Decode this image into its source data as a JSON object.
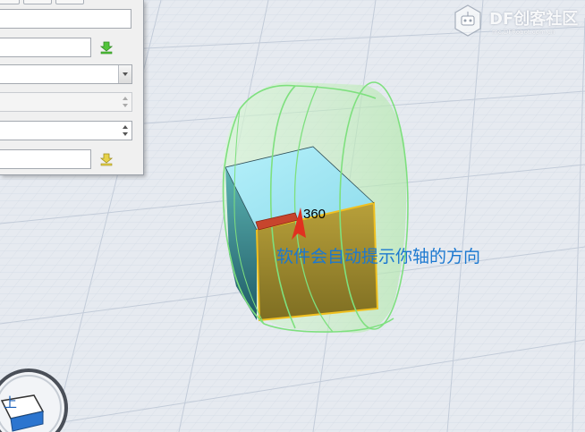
{
  "annotation": {
    "text": "软件会自动提示你轴的方向"
  },
  "dimension": {
    "value": "360"
  },
  "watermark": {
    "brand_prefix": "DF",
    "brand_name": "创客社区",
    "url": "mc.DFRobot.com.cn"
  },
  "view_cube": {
    "face_label": "上"
  },
  "colors": {
    "grid_background": "#e6eaf0",
    "grid_line": "#c9d2de",
    "annotation_text": "#1b78d0",
    "cylinder_outline": "#7ee07e",
    "cube_front": "#9c8a2c",
    "cube_top": "#a8ecf6",
    "cube_side": "#4fa6a6",
    "axis_arrow": "#e03020",
    "highlight_edge": "#f0c020"
  },
  "icons": {
    "pick_active": "download-arrow-green-icon",
    "pick_inactive": "download-arrow-yellow-icon"
  }
}
